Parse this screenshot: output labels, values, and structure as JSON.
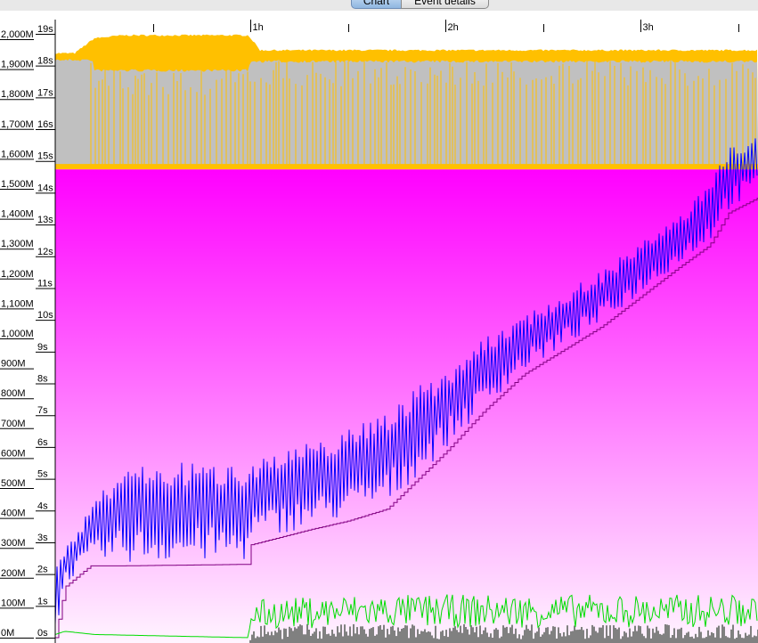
{
  "tabs": [
    {
      "label": "Chart",
      "selected": true
    },
    {
      "label": "Event details",
      "selected": false
    }
  ],
  "chart_data": {
    "type": "area",
    "x_unit": "hours",
    "xlim": [
      0,
      3.6
    ],
    "x_ticks": [
      {
        "value": 0.5,
        "label": ""
      },
      {
        "value": 1,
        "label": "1h"
      },
      {
        "value": 1.5,
        "label": ""
      },
      {
        "value": 2,
        "label": "2h"
      },
      {
        "value": 2.5,
        "label": ""
      },
      {
        "value": 3,
        "label": "3h"
      },
      {
        "value": 3.5,
        "label": ""
      }
    ],
    "y_left": {
      "unit": "M",
      "ylim": [
        0,
        2000
      ],
      "ticks": [
        0,
        100,
        200,
        300,
        400,
        500,
        600,
        700,
        800,
        900,
        1000,
        1100,
        1200,
        1300,
        1400,
        1500,
        1600,
        1700,
        1800,
        1900,
        2000
      ],
      "tick_labels": [
        "0M",
        "100M",
        "200M",
        "300M",
        "400M",
        "500M",
        "600M",
        "700M",
        "800M",
        "900M",
        "1,000M",
        "1,100M",
        "1,200M",
        "1,300M",
        "1,400M",
        "1,500M",
        "1,600M",
        "1,700M",
        "1,800M",
        "1,900M",
        "2,000M"
      ]
    },
    "y_right": {
      "unit": "s",
      "ylim": [
        0,
        19
      ],
      "ticks": [
        0,
        1,
        2,
        3,
        4,
        5,
        6,
        7,
        8,
        9,
        10,
        11,
        12,
        13,
        14,
        15,
        16,
        17,
        18,
        19
      ],
      "tick_labels": [
        "0s",
        "1s",
        "2s",
        "3s",
        "4s",
        "5s",
        "6s",
        "7s",
        "8s",
        "9s",
        "10s",
        "11s",
        "12s",
        "13s",
        "14s",
        "15s",
        "16s",
        "17s",
        "18s",
        "19s"
      ]
    },
    "series": [
      {
        "color": "#ffc000",
        "kind": "band",
        "axis": "left",
        "x": [
          0.0,
          0.1,
          0.2,
          0.35,
          0.6,
          0.99,
          1.05,
          1.5,
          2.0,
          2.5,
          3.0,
          3.6
        ],
        "values": [
          1950,
          1950,
          2000,
          2010,
          2010,
          2010,
          1960,
          1960,
          1960,
          1960,
          1960,
          1960
        ]
      },
      {
        "color": "#c0c0c0",
        "kind": "band",
        "axis": "left",
        "x": [
          0.0,
          0.19,
          0.2,
          0.99,
          1.0,
          3.6
        ],
        "values": [
          1935,
          1935,
          1900,
          1900,
          1930,
          1930
        ]
      },
      {
        "color": "#ff00ff",
        "kind": "area",
        "axis": "left",
        "x": [
          0,
          3.6
        ],
        "values": [
          1565,
          1565
        ]
      },
      {
        "color": "#0000ff",
        "kind": "line",
        "axis": "left",
        "x": [
          0.0,
          0.05,
          0.18,
          0.35,
          0.99,
          1.0,
          1.3,
          1.5,
          1.7,
          2.0,
          2.2,
          2.4,
          2.6,
          2.8,
          3.0,
          3.2,
          3.35,
          3.45,
          3.6
        ],
        "values": [
          230,
          300,
          440,
          580,
          590,
          600,
          650,
          700,
          770,
          900,
          1000,
          1080,
          1150,
          1230,
          1320,
          1410,
          1530,
          1640,
          1700
        ]
      },
      {
        "color": "#800080",
        "kind": "line",
        "axis": "left",
        "x": [
          0.0,
          0.05,
          0.18,
          0.35,
          0.99,
          1.0,
          1.3,
          1.5,
          1.7,
          2.0,
          2.2,
          2.4,
          2.6,
          2.8,
          3.0,
          3.2,
          3.35,
          3.45,
          3.6
        ],
        "values": [
          0,
          170,
          240,
          240,
          245,
          310,
          360,
          390,
          430,
          620,
          760,
          880,
          960,
          1040,
          1140,
          1240,
          1310,
          1420,
          1470
        ]
      },
      {
        "color": "#00dd00",
        "kind": "line",
        "axis": "right",
        "x": [
          0.0,
          0.05,
          0.2,
          0.99,
          1.0,
          1.5,
          2.0,
          2.5,
          3.0,
          3.6
        ],
        "values": [
          0.1,
          0.2,
          0.1,
          0.0,
          0.7,
          0.8,
          0.8,
          0.8,
          0.8,
          0.8
        ]
      },
      {
        "color": "#808080",
        "kind": "area",
        "axis": "right",
        "x": [
          0.0,
          0.99,
          1.0,
          3.6
        ],
        "values": [
          0.0,
          0.0,
          0.3,
          0.3
        ]
      }
    ],
    "grid": false,
    "legend": "none"
  }
}
